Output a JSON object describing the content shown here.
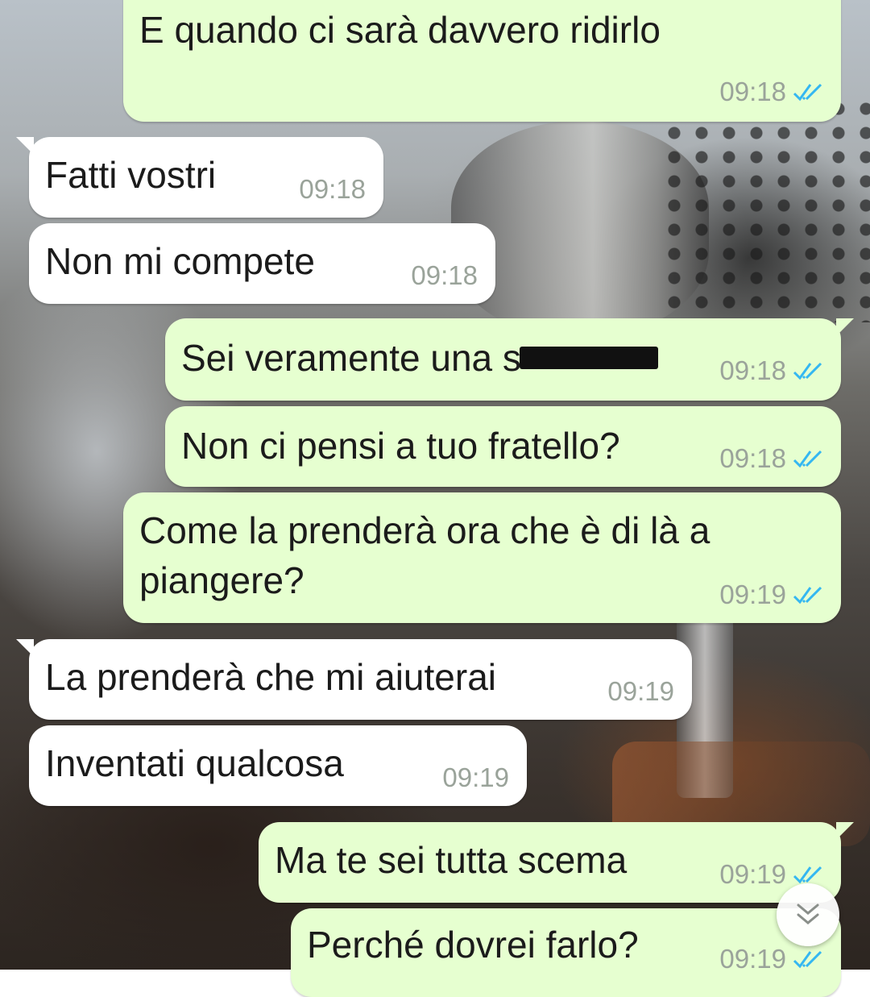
{
  "chat": {
    "messages": [
      {
        "direction": "out",
        "text": "E quando ci sarà davvero ridirlo",
        "time": "09:18",
        "status": "read"
      },
      {
        "direction": "in",
        "text": "Fatti vostri",
        "time": "09:18"
      },
      {
        "direction": "in",
        "text": "Non mi compete",
        "time": "09:18"
      },
      {
        "direction": "out",
        "text": "Sei veramente una s",
        "redacted": true,
        "time": "09:18",
        "status": "read"
      },
      {
        "direction": "out",
        "text": "Non ci pensi a tuo fratello?",
        "time": "09:18",
        "status": "read"
      },
      {
        "direction": "out",
        "line1": "Come la prenderà ora che è di là a",
        "line2": "piangere?",
        "time": "09:19",
        "status": "read"
      },
      {
        "direction": "in",
        "text": "La prenderà che mi aiuterai",
        "time": "09:19"
      },
      {
        "direction": "in",
        "text": "Inventati qualcosa",
        "time": "09:19"
      },
      {
        "direction": "out",
        "text": "Ma te sei tutta scema",
        "time": "09:19",
        "status": "read"
      },
      {
        "direction": "out",
        "text": "Perché dovrei farlo?",
        "time": "09:19",
        "status": "read"
      }
    ],
    "scroll_button_icon": "double-chevron-down-icon"
  },
  "colors": {
    "outgoing_bubble": "#e6ffd0",
    "incoming_bubble": "#ffffff",
    "read_ticks": "#34b7f1",
    "timestamp": "#9aa39a"
  }
}
